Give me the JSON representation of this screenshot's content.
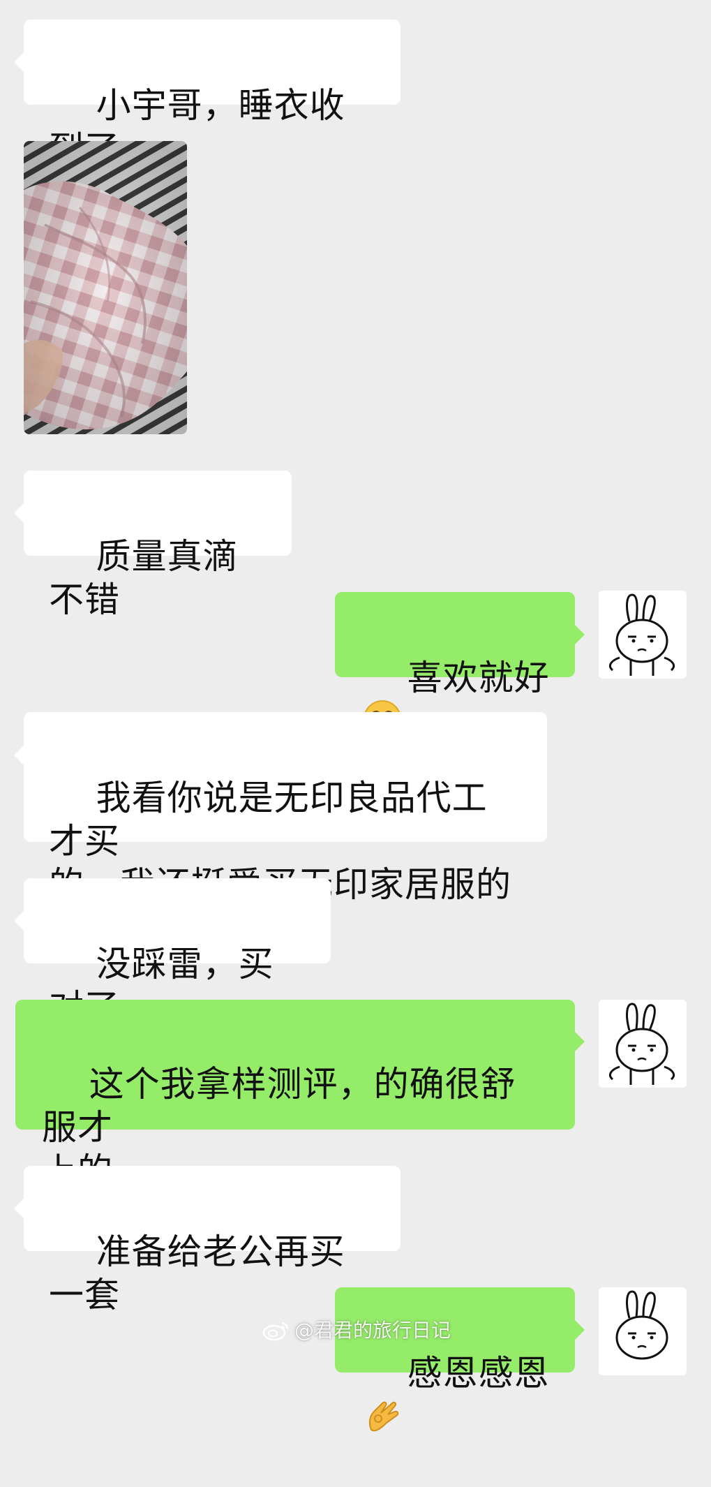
{
  "messages": [
    {
      "side": "left",
      "text": "小宇哥，睡衣收到了"
    },
    {
      "side": "left",
      "type": "image",
      "content": "pink-plaid-pajamas-photo"
    },
    {
      "side": "left",
      "text": "质量真滴不错"
    },
    {
      "side": "right",
      "text": "喜欢就好",
      "emoji": "grinning-face-emoji"
    },
    {
      "side": "left",
      "text": "我看你说是无印良品代工才买\n的，我还挺爱买无印家居服的"
    },
    {
      "side": "left",
      "text": "没踩雷，买对了"
    },
    {
      "side": "right",
      "text": "这个我拿样测评，的确很舒服才\n上的"
    },
    {
      "side": "left",
      "text": "准备给老公再买一套"
    },
    {
      "side": "right",
      "text": "感恩感恩",
      "emoji": "ok-hand-emoji"
    }
  ],
  "watermark": {
    "icon": "weibo-icon",
    "text": "@君君的旅行日记"
  },
  "avatar": {
    "icon": "cartoon-rabbit-avatar"
  },
  "colors": {
    "background": "#ededed",
    "incoming_bubble": "#ffffff",
    "outgoing_bubble": "#95ec69",
    "text": "#111111"
  }
}
